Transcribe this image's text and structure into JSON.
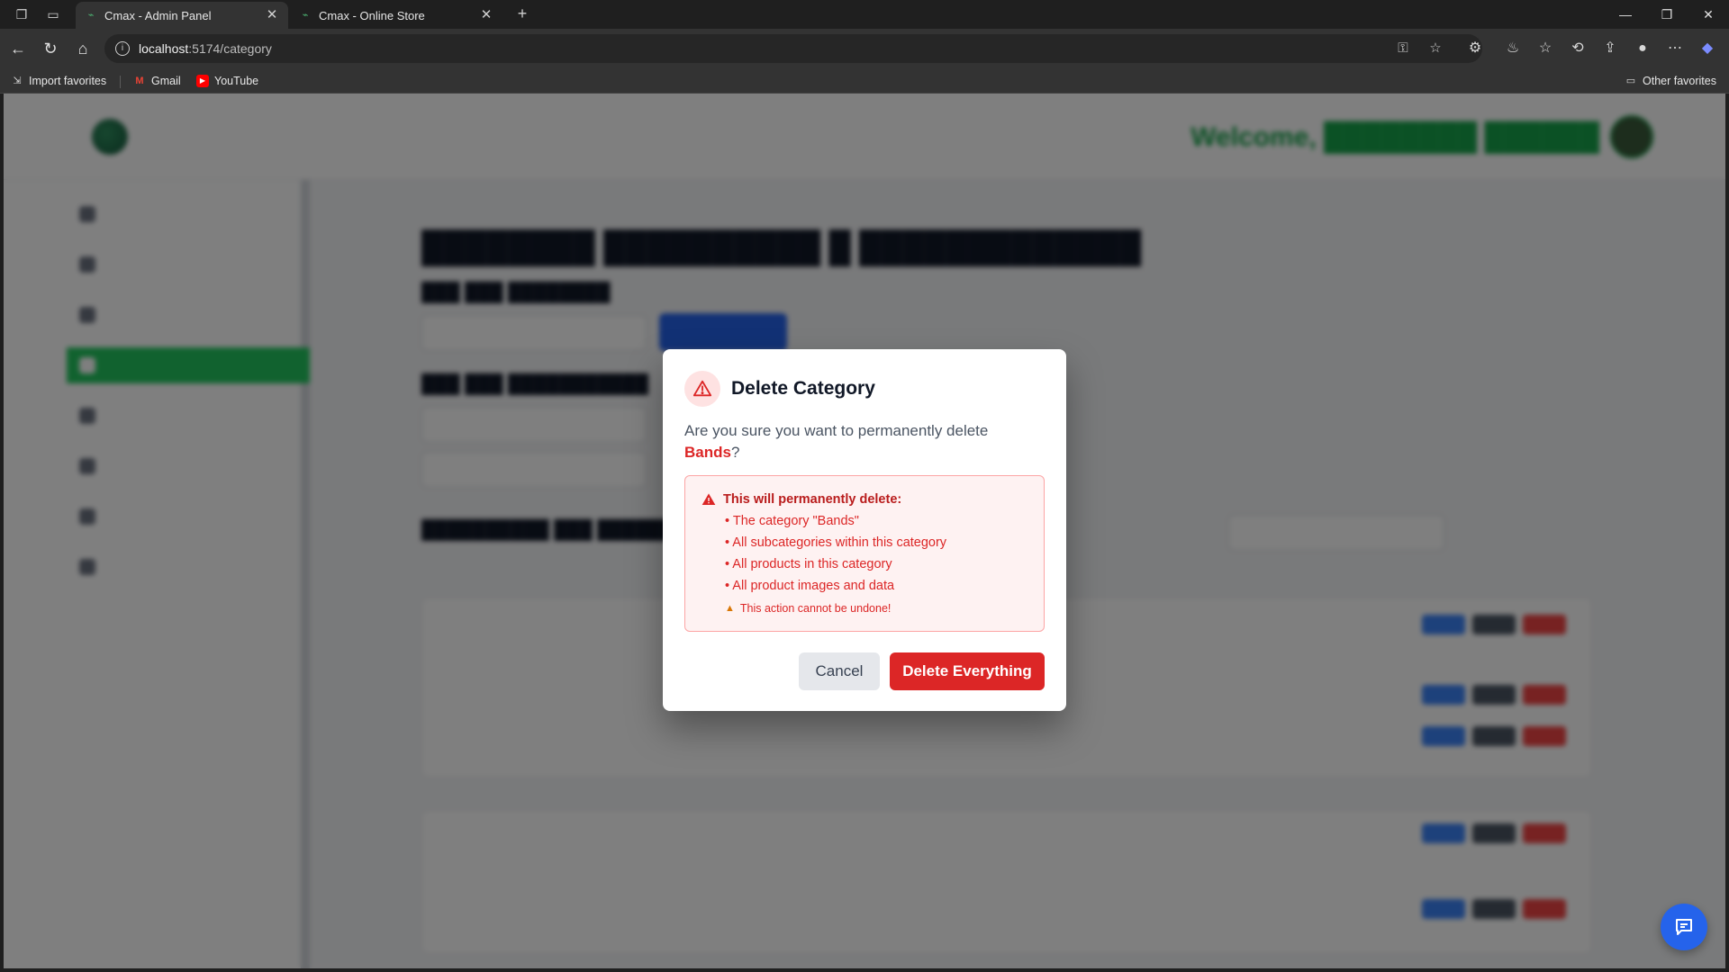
{
  "browser": {
    "tabs": [
      {
        "title": "Cmax - Admin Panel"
      },
      {
        "title": "Cmax - Online Store"
      }
    ],
    "url_host": "localhost",
    "url_path": ":5174/category",
    "bookmarks": [
      {
        "label": "Import favorites"
      },
      {
        "label": "Gmail"
      },
      {
        "label": "YouTube"
      }
    ],
    "other_favorites": "Other favorites"
  },
  "modal": {
    "title": "Delete Category",
    "message_prefix": "Are you sure you want to permanently delete ",
    "target_name": "Bands",
    "message_suffix": "?",
    "warning_heading": "This will permanently delete:",
    "items": [
      "• The category \"Bands\"",
      "• All subcategories within this category",
      "• All products in this category",
      "• All product images and data"
    ],
    "note": "This action cannot be undone!",
    "cancel_label": "Cancel",
    "confirm_label": "Delete Everything"
  },
  "colors": {
    "danger": "#dc2626",
    "danger_bg": "#fef2f2",
    "brand_green": "#22c55e",
    "primary_blue": "#2563eb"
  },
  "icons": {
    "modal_warning": "alert-triangle-icon",
    "chat": "chat-bubble-icon"
  }
}
